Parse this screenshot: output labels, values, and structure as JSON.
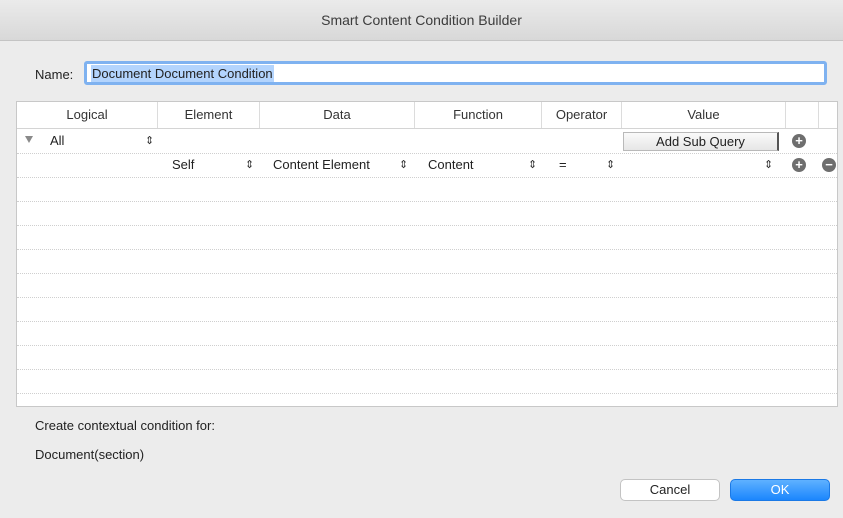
{
  "window": {
    "title": "Smart Content Condition Builder"
  },
  "name_field": {
    "label": "Name:",
    "value": "Document Document Condition"
  },
  "table": {
    "columns": [
      "Logical",
      "Element",
      "Data",
      "Function",
      "Operator",
      "Value"
    ],
    "rows": [
      {
        "logical": "All",
        "add_sub_query": "Add Sub Query"
      },
      {
        "element": "Self",
        "data": "Content Element",
        "function": "Content",
        "operator": "=",
        "value": ""
      }
    ]
  },
  "footer": {
    "prompt": "Create contextual condition for:",
    "context": "Document(section)"
  },
  "buttons": {
    "cancel": "Cancel",
    "ok": "OK"
  },
  "colors": {
    "accent": "#1b86fd",
    "selection": "#b3d4fd",
    "focus_ring": "#7fb2f0"
  }
}
